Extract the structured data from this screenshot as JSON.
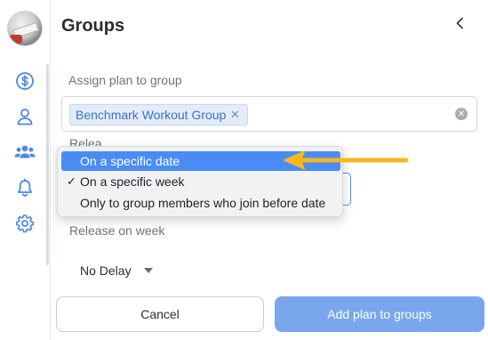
{
  "rail": {
    "icons": [
      "dollar-icon",
      "user-icon",
      "users-icon",
      "bell-icon",
      "gear-icon"
    ]
  },
  "header": {
    "title": "Groups"
  },
  "assign": {
    "label": "Assign plan to group",
    "chip_label": "Benchmark Workout Group"
  },
  "release": {
    "partial_label": "Relea",
    "week_label": "Release on week",
    "delay_value": "No Delay"
  },
  "menu": {
    "items": [
      {
        "label": "On a specific date",
        "highlighted": true,
        "checked": false
      },
      {
        "label": "On a specific week",
        "highlighted": false,
        "checked": true
      },
      {
        "label": "Only to group members who join before date",
        "highlighted": false,
        "checked": false
      }
    ],
    "check_glyph": "✓"
  },
  "footer": {
    "cancel_label": "Cancel",
    "add_label": "Add plan to groups"
  },
  "colors": {
    "accent": "#4a8cf5",
    "primary_button": "#7aa6ee",
    "chip_bg": "#e3ecfa",
    "chip_text": "#3b73c9",
    "annotation_arrow": "#f5b81c",
    "rail_icon": "#4a86e8"
  }
}
